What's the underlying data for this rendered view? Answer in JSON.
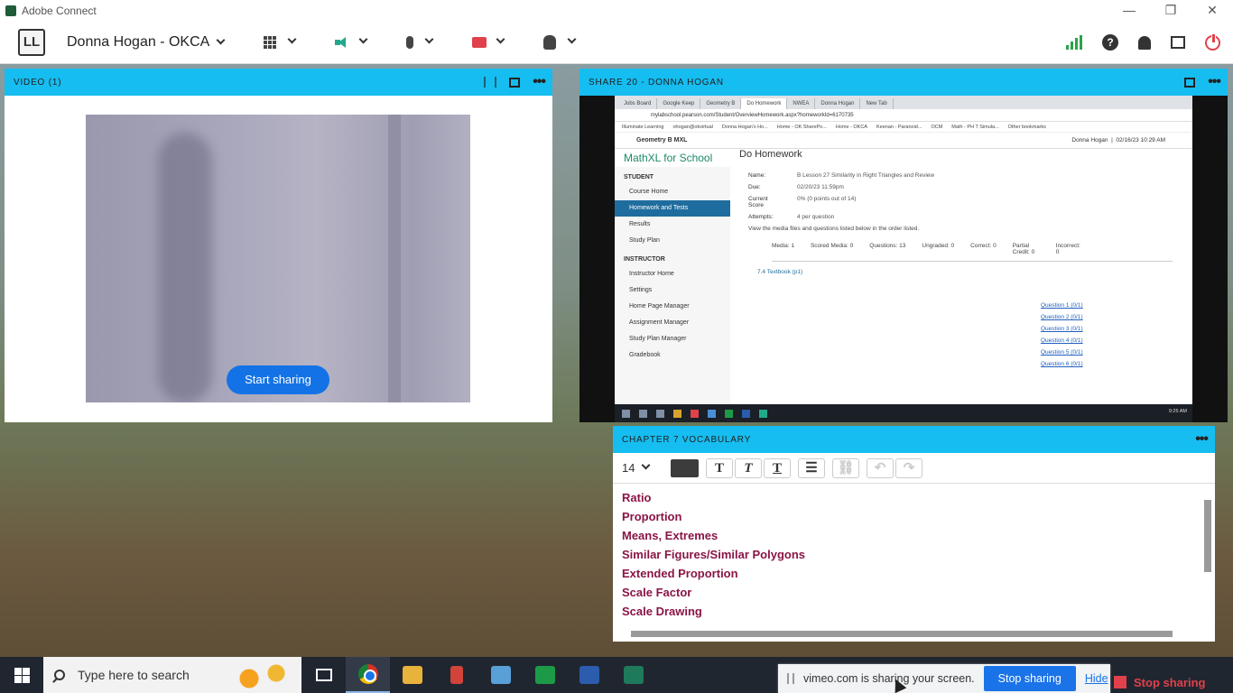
{
  "window": {
    "title": "Adobe Connect",
    "min": "—",
    "restore": "❐",
    "close": "✕"
  },
  "toolbar": {
    "logo_text": "LL",
    "host": "Donna Hogan - OKCA"
  },
  "video_pod": {
    "title": "VIDEO (1)",
    "start_sharing": "Start sharing"
  },
  "share_pod": {
    "title": "SHARE 20  - DONNA HOGAN",
    "browser_tabs": [
      "Jobs Board",
      "Google Keep",
      "Geometry B",
      "Do Homework",
      "NWEA",
      "Donna Hogan",
      "New Tab"
    ],
    "url": "mylabschool.pearson.com/Student/OverviewHomework.aspx?homeworkId=6170735",
    "bookmarks": [
      "Illuminate Learning",
      "ohogan@okvirtual",
      "Donna Hogan's Ho...",
      "Home - OK SharePo...",
      "Home - OKCA",
      "Keenan - Paranoid...",
      "OCM",
      "Math - PH T Simula...",
      "Other bookmarks"
    ],
    "course": "Geometry B MXL",
    "user": "Donna Hogan",
    "datetime": "02/16/23 10:29 AM",
    "brand": "MathXL for School",
    "page_title": "Do Homework",
    "sections": {
      "student": "STUDENT",
      "student_items": [
        "Course Home",
        "Homework and Tests",
        "Results",
        "Study Plan"
      ],
      "instructor": "INSTRUCTOR",
      "instructor_items": [
        "Instructor Home",
        "Settings",
        "Home Page Manager",
        "Assignment Manager",
        "Study Plan Manager",
        "Gradebook"
      ]
    },
    "details": {
      "name_k": "Name:",
      "name_v": "B Lesson 27 Similarity in Right Triangles and Review",
      "due_k": "Due:",
      "due_v": "02/20/23 11:59pm",
      "score_k": "Current Score",
      "score_v": "0% (0 points out of 14)",
      "attempts_k": "Attempts:",
      "attempts_v": "4 per question",
      "instructions": "View the media files and questions listed below in the order listed."
    },
    "stats": [
      "Media: 1",
      "Scored Media: 0",
      "Questions: 13",
      "Ungraded: 0",
      "Correct: 0",
      "Partial Credit: 0",
      "Incorrect: 0"
    ],
    "textbook": "7.4 Textbook (p1)",
    "questions": [
      "Question 1 (0/1)",
      "Question 2 (0/1)",
      "Question 3 (0/1)",
      "Question 4 (0/1)",
      "Question 5 (0/1)",
      "Question 6 (0/1)"
    ],
    "clock": "9:25 AM"
  },
  "notes_pod": {
    "title": "CHAPTER 7 VOCABULARY",
    "font_size": "14",
    "bold": "T",
    "italic": "T",
    "underline": "T",
    "undo": "↶",
    "redo": "↷",
    "items": [
      "Ratio",
      "Proportion",
      "Means, Extremes",
      "Similar Figures/Similar Polygons",
      "Extended Proportion",
      "Scale Factor",
      "Scale Drawing"
    ]
  },
  "taskbar": {
    "search_placeholder": "Type here to search"
  },
  "share_bar": {
    "message": "vimeo.com is sharing your screen.",
    "stop": "Stop sharing",
    "hide": "Hide",
    "stop_red": "Stop sharing"
  },
  "colors": {
    "accent": "#16bdf0",
    "vocab": "#8a1546",
    "stop": "#e0414b",
    "primary": "#1373e6"
  }
}
